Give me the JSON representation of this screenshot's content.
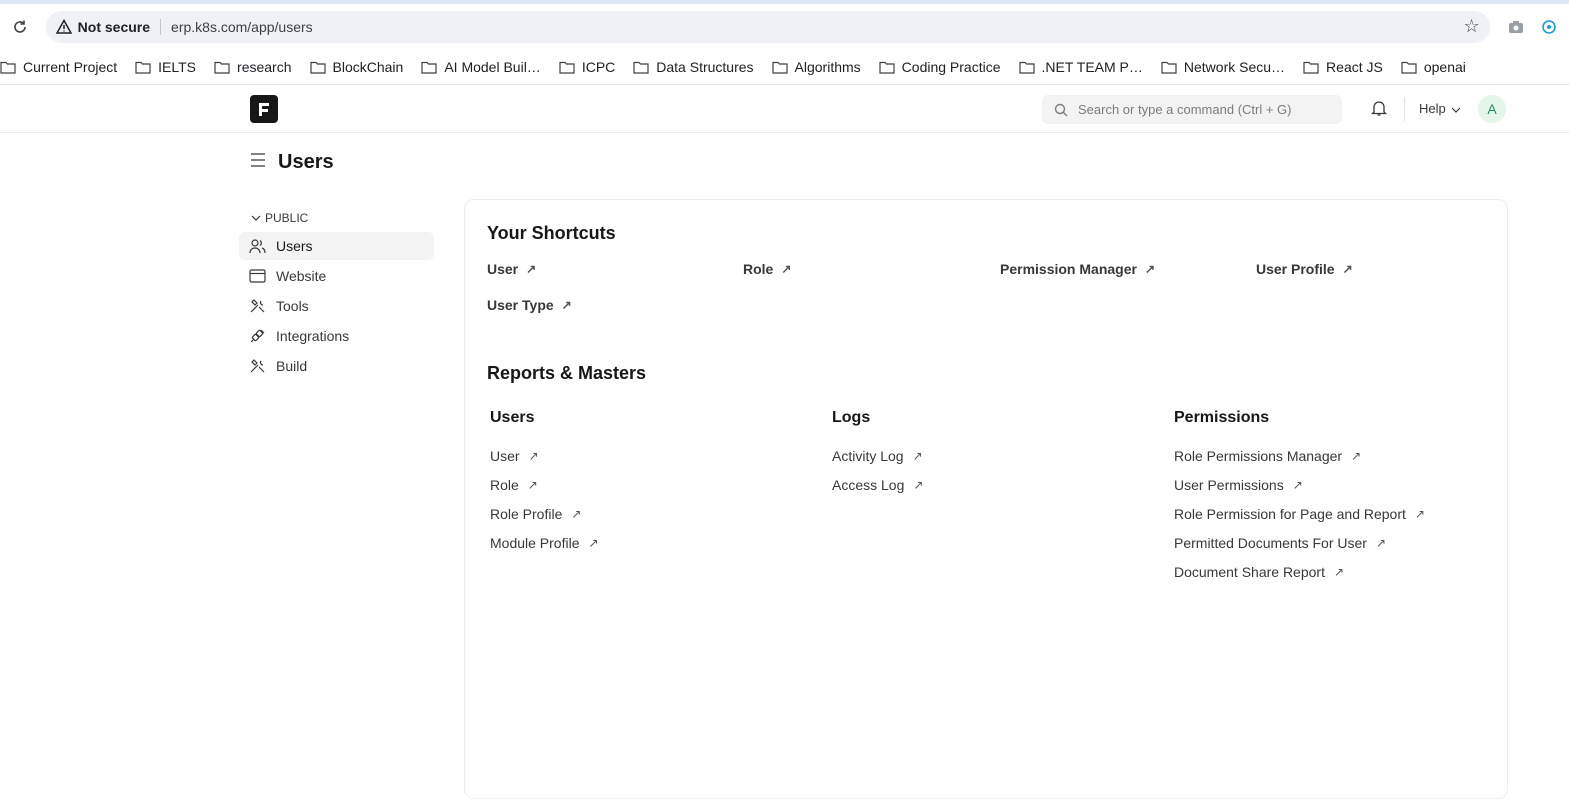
{
  "browser": {
    "security_label": "Not secure",
    "url": "erp.k8s.com/app/users",
    "bookmarks": [
      "Current Project",
      "IELTS",
      "research",
      "BlockChain",
      "AI Model Buil…",
      "ICPC",
      "Data Structures",
      "Algorithms",
      "Coding Practice",
      ".NET TEAM P…",
      "Network Secu…",
      "React JS",
      "openai"
    ]
  },
  "header": {
    "search_placeholder": "Search or type a command (Ctrl + G)",
    "help_label": "Help",
    "avatar_initial": "A"
  },
  "page": {
    "title": "Users"
  },
  "sidebar": {
    "section_label": "PUBLIC",
    "items": [
      {
        "label": "Users",
        "icon": "users-icon"
      },
      {
        "label": "Website",
        "icon": "website-icon"
      },
      {
        "label": "Tools",
        "icon": "tools-icon"
      },
      {
        "label": "Integrations",
        "icon": "integrations-icon"
      },
      {
        "label": "Build",
        "icon": "build-icon"
      }
    ]
  },
  "shortcuts": {
    "title": "Your Shortcuts",
    "items": [
      "User",
      "Role",
      "Permission Manager",
      "User Profile",
      "User Type"
    ]
  },
  "reports": {
    "title": "Reports & Masters",
    "columns": [
      {
        "title": "Users",
        "links": [
          "User",
          "Role",
          "Role Profile",
          "Module Profile"
        ]
      },
      {
        "title": "Logs",
        "links": [
          "Activity Log",
          "Access Log"
        ]
      },
      {
        "title": "Permissions",
        "links": [
          "Role Permissions Manager",
          "User Permissions",
          "Role Permission for Page and Report",
          "Permitted Documents For User",
          "Document Share Report"
        ]
      }
    ]
  },
  "icons": {
    "arrow": "↗"
  }
}
